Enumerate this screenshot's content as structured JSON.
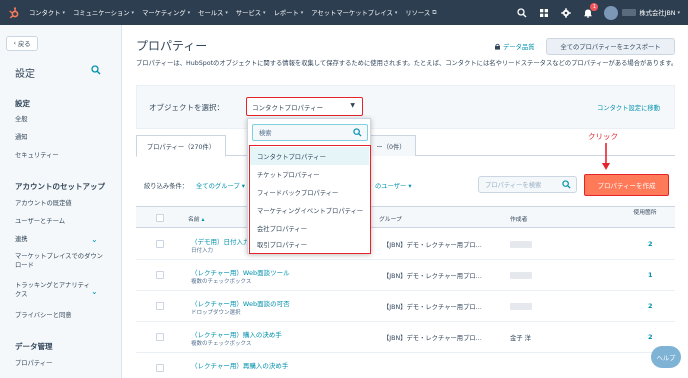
{
  "topnav": {
    "logo": "hubspot-logo",
    "menu": [
      "コンタクト",
      "コミュニケーション",
      "マーケティング",
      "セールス",
      "サービス",
      "レポート",
      "アセットマーケットプレイス",
      "リソース"
    ],
    "notifications": "1",
    "account_name": "株式会社JBN"
  },
  "sidebar": {
    "back": "戻る",
    "title": "設定",
    "sections": [
      {
        "heading": "設定",
        "items": [
          "全般",
          "通知",
          "セキュリティー"
        ]
      },
      {
        "heading": "アカウントのセットアップ",
        "items": [
          "アカウントの既定値",
          "ユーザーとチーム",
          "連携",
          "マーケットプレイスでのダウンロード",
          "トラッキングとアナリティクス",
          "プライバシーと同意"
        ]
      },
      {
        "heading": "データ管理",
        "items": [
          "プロパティー"
        ]
      }
    ]
  },
  "main": {
    "title": "プロパティー",
    "data_quality": "データ品質",
    "export_button": "全てのプロパティーをエクスポート",
    "description": "プロパティーは、HubSpotのオブジェクトに関する情報を収集して保存するために使用されます。たとえば、コンタクトには名やリードステータスなどのプロパティーがある場合があります。",
    "object_label": "オブジェクトを選択：",
    "object_selected": "コンタクトプロパティー",
    "object_settings_link": "コンタクト設定に移動",
    "tabs": [
      "プロパティー（270件）",
      "ー（0件）"
    ],
    "filter_label": "絞り込み条件：",
    "filter_group": "全てのグループ",
    "filter_users": "のユーザー",
    "search_placeholder": "プロパティーを検索",
    "create_button": "プロパティーを作成",
    "annotation": "クリック",
    "table": {
      "headers": {
        "name": "名前",
        "group": "グループ",
        "author": "作成者",
        "usage": "使用箇所"
      },
      "rows": [
        {
          "name": "（デモ用）日付入力",
          "type": "日付入力",
          "group": "【JBN】デモ・レクチャー用プロ…",
          "author": "",
          "usage": "2"
        },
        {
          "name": "（レクチャー用）Web面談ツール",
          "type": "複数のチェックボックス",
          "group": "【JBN】デモ・レクチャー用プロ…",
          "author": "",
          "usage": "1"
        },
        {
          "name": "（レクチャー用）Web面談の可否",
          "type": "ドロップダウン選択",
          "group": "【JBN】デモ・レクチャー用プロ…",
          "author": "",
          "usage": "2"
        },
        {
          "name": "（レクチャー用）購入の決め手",
          "type": "複数のチェックボックス",
          "group": "【JBN】デモ・レクチャー用プロ…",
          "author": "金子 洋",
          "usage": "2"
        },
        {
          "name": "（レクチャー用）再購入の決め手",
          "type": "",
          "group": "",
          "author": "",
          "usage": ""
        }
      ]
    }
  },
  "dropdown": {
    "search_placeholder": "検索",
    "items": [
      "コンタクトプロパティー",
      "チケットプロパティー",
      "フィードバックプロパティー",
      "マーケティングイベントプロパティー",
      "会社プロパティー",
      "取引プロパティー"
    ]
  },
  "help": "ヘルプ",
  "colors": {
    "nav": "#2d3e50",
    "accent": "#ff7a59",
    "link": "#0091ae",
    "highlight": "#e5242a"
  }
}
